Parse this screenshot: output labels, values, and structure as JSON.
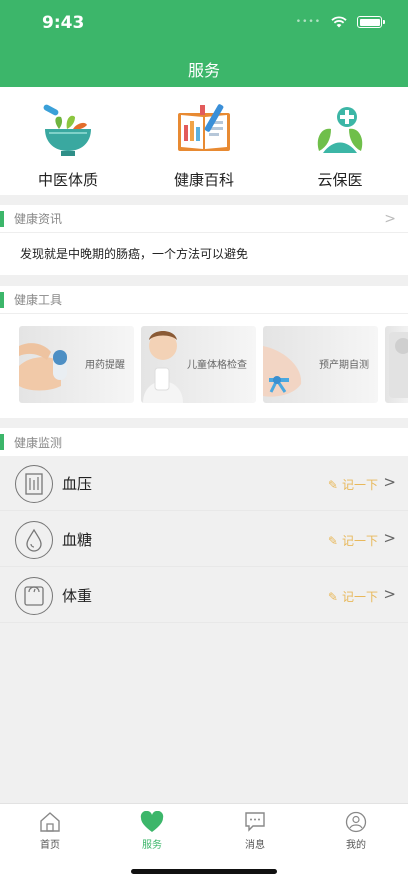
{
  "status": {
    "time": "9:43"
  },
  "header": {
    "title": "服务"
  },
  "services": [
    {
      "label": "中医体质",
      "icon": "mortar-herbs-icon"
    },
    {
      "label": "健康百科",
      "icon": "open-book-icon"
    },
    {
      "label": "云保医",
      "icon": "cloud-medical-icon"
    }
  ],
  "news": {
    "title": "健康资讯",
    "headline": "发现就是中晚期的肠癌，一个方法可以避免"
  },
  "tools": {
    "title": "健康工具",
    "items": [
      {
        "label": "用药提醒"
      },
      {
        "label": "儿童体格检查"
      },
      {
        "label": "预产期自测"
      }
    ]
  },
  "monitor": {
    "title": "健康监测",
    "rows": [
      {
        "name": "血压",
        "action": "记一下"
      },
      {
        "name": "血糖",
        "action": "记一下"
      },
      {
        "name": "体重",
        "action": "记一下"
      }
    ]
  },
  "tabs": [
    {
      "label": "首页",
      "icon": "home-icon"
    },
    {
      "label": "服务",
      "icon": "heart-icon"
    },
    {
      "label": "消息",
      "icon": "message-icon"
    },
    {
      "label": "我的",
      "icon": "profile-icon"
    }
  ],
  "colors": {
    "brand": "#3cb66a",
    "record": "#e8b85a"
  }
}
